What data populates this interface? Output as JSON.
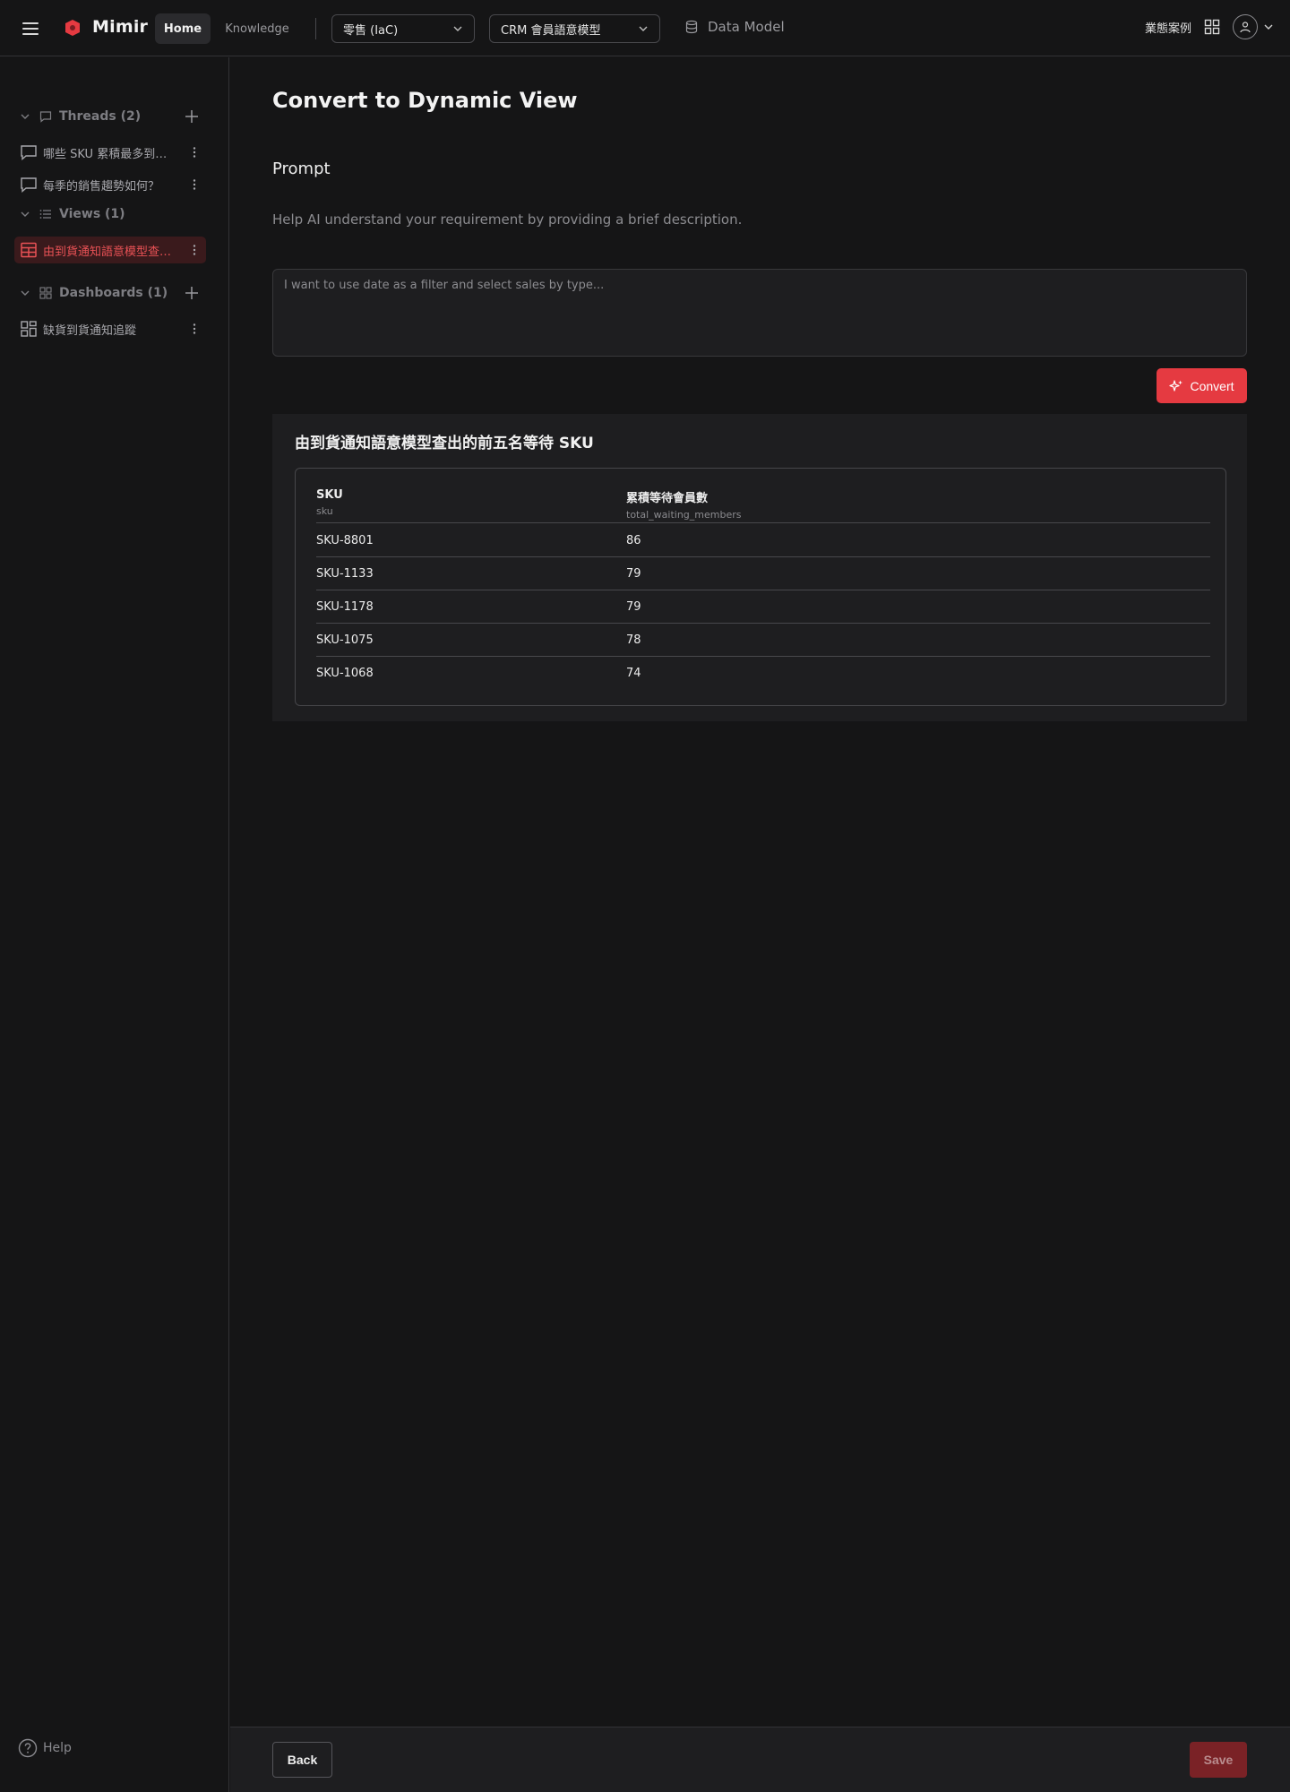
{
  "header": {
    "brand": "Mimir",
    "tabs": {
      "home": "Home",
      "knowledge": "Knowledge"
    },
    "project_select": "零售 (IaC)",
    "model_select": "CRM 會員語意模型",
    "data_model": "Data Model",
    "cases": "業態案例",
    "icons": [
      "menu-icon",
      "logo-icon",
      "chevron-down-icon",
      "database-icon",
      "grid-icon",
      "user-icon"
    ]
  },
  "sidebar": {
    "threads": {
      "title": "Threads (2)",
      "items": [
        {
          "label": "哪些 SKU 累積最多到貨通知"
        },
        {
          "label": "每季的銷售趨勢如何？"
        }
      ]
    },
    "views": {
      "title": "Views (1)",
      "items": [
        {
          "label": "由到貨通知語意模型查出的前五名"
        }
      ]
    },
    "dashboards": {
      "title": "Dashboards (1)",
      "items": [
        {
          "label": "缺貨到貨通知追蹤"
        }
      ]
    },
    "help": "Help"
  },
  "main": {
    "title": "Convert to Dynamic View",
    "prompt_title": "Prompt",
    "prompt_desc": "Help AI understand your requirement by providing a brief description.",
    "prompt_placeholder": "I want to use date as a filter and select sales by type...",
    "convert_label": "Convert",
    "result": {
      "title": "由到貨通知語意模型查出的前五名等待 SKU",
      "columns": [
        {
          "label": "SKU",
          "field": "sku"
        },
        {
          "label": "累積等待會員數",
          "field": "total_waiting_members"
        }
      ],
      "rows": [
        [
          "SKU-8801",
          "86"
        ],
        [
          "SKU-1133",
          "79"
        ],
        [
          "SKU-1178",
          "79"
        ],
        [
          "SKU-1075",
          "78"
        ],
        [
          "SKU-1068",
          "74"
        ]
      ]
    }
  },
  "footer": {
    "back": "Back",
    "save": "Save"
  },
  "colors": {
    "accent": "#e53a41",
    "background": "#151516",
    "panel": "#1e1e20"
  }
}
